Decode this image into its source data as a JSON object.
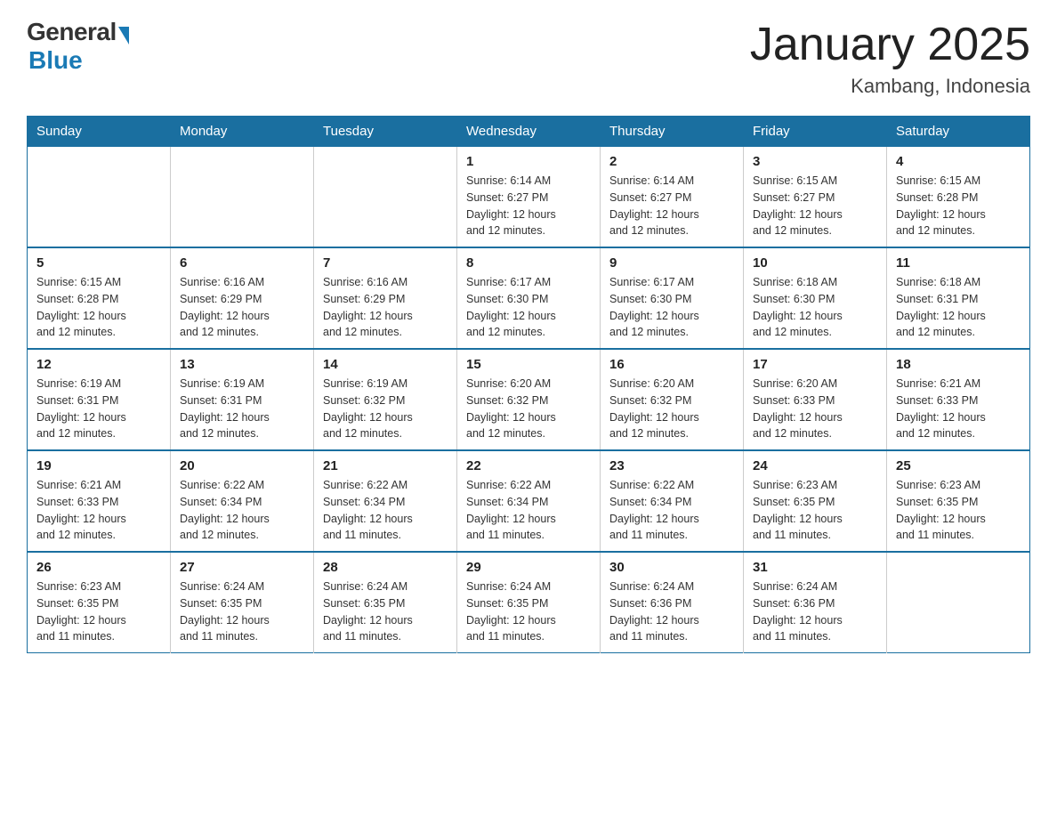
{
  "header": {
    "logo_general": "General",
    "logo_blue": "Blue",
    "title": "January 2025",
    "location": "Kambang, Indonesia"
  },
  "weekdays": [
    "Sunday",
    "Monday",
    "Tuesday",
    "Wednesday",
    "Thursday",
    "Friday",
    "Saturday"
  ],
  "weeks": [
    [
      {
        "day": "",
        "info": ""
      },
      {
        "day": "",
        "info": ""
      },
      {
        "day": "",
        "info": ""
      },
      {
        "day": "1",
        "info": "Sunrise: 6:14 AM\nSunset: 6:27 PM\nDaylight: 12 hours\nand 12 minutes."
      },
      {
        "day": "2",
        "info": "Sunrise: 6:14 AM\nSunset: 6:27 PM\nDaylight: 12 hours\nand 12 minutes."
      },
      {
        "day": "3",
        "info": "Sunrise: 6:15 AM\nSunset: 6:27 PM\nDaylight: 12 hours\nand 12 minutes."
      },
      {
        "day": "4",
        "info": "Sunrise: 6:15 AM\nSunset: 6:28 PM\nDaylight: 12 hours\nand 12 minutes."
      }
    ],
    [
      {
        "day": "5",
        "info": "Sunrise: 6:15 AM\nSunset: 6:28 PM\nDaylight: 12 hours\nand 12 minutes."
      },
      {
        "day": "6",
        "info": "Sunrise: 6:16 AM\nSunset: 6:29 PM\nDaylight: 12 hours\nand 12 minutes."
      },
      {
        "day": "7",
        "info": "Sunrise: 6:16 AM\nSunset: 6:29 PM\nDaylight: 12 hours\nand 12 minutes."
      },
      {
        "day": "8",
        "info": "Sunrise: 6:17 AM\nSunset: 6:30 PM\nDaylight: 12 hours\nand 12 minutes."
      },
      {
        "day": "9",
        "info": "Sunrise: 6:17 AM\nSunset: 6:30 PM\nDaylight: 12 hours\nand 12 minutes."
      },
      {
        "day": "10",
        "info": "Sunrise: 6:18 AM\nSunset: 6:30 PM\nDaylight: 12 hours\nand 12 minutes."
      },
      {
        "day": "11",
        "info": "Sunrise: 6:18 AM\nSunset: 6:31 PM\nDaylight: 12 hours\nand 12 minutes."
      }
    ],
    [
      {
        "day": "12",
        "info": "Sunrise: 6:19 AM\nSunset: 6:31 PM\nDaylight: 12 hours\nand 12 minutes."
      },
      {
        "day": "13",
        "info": "Sunrise: 6:19 AM\nSunset: 6:31 PM\nDaylight: 12 hours\nand 12 minutes."
      },
      {
        "day": "14",
        "info": "Sunrise: 6:19 AM\nSunset: 6:32 PM\nDaylight: 12 hours\nand 12 minutes."
      },
      {
        "day": "15",
        "info": "Sunrise: 6:20 AM\nSunset: 6:32 PM\nDaylight: 12 hours\nand 12 minutes."
      },
      {
        "day": "16",
        "info": "Sunrise: 6:20 AM\nSunset: 6:32 PM\nDaylight: 12 hours\nand 12 minutes."
      },
      {
        "day": "17",
        "info": "Sunrise: 6:20 AM\nSunset: 6:33 PM\nDaylight: 12 hours\nand 12 minutes."
      },
      {
        "day": "18",
        "info": "Sunrise: 6:21 AM\nSunset: 6:33 PM\nDaylight: 12 hours\nand 12 minutes."
      }
    ],
    [
      {
        "day": "19",
        "info": "Sunrise: 6:21 AM\nSunset: 6:33 PM\nDaylight: 12 hours\nand 12 minutes."
      },
      {
        "day": "20",
        "info": "Sunrise: 6:22 AM\nSunset: 6:34 PM\nDaylight: 12 hours\nand 12 minutes."
      },
      {
        "day": "21",
        "info": "Sunrise: 6:22 AM\nSunset: 6:34 PM\nDaylight: 12 hours\nand 11 minutes."
      },
      {
        "day": "22",
        "info": "Sunrise: 6:22 AM\nSunset: 6:34 PM\nDaylight: 12 hours\nand 11 minutes."
      },
      {
        "day": "23",
        "info": "Sunrise: 6:22 AM\nSunset: 6:34 PM\nDaylight: 12 hours\nand 11 minutes."
      },
      {
        "day": "24",
        "info": "Sunrise: 6:23 AM\nSunset: 6:35 PM\nDaylight: 12 hours\nand 11 minutes."
      },
      {
        "day": "25",
        "info": "Sunrise: 6:23 AM\nSunset: 6:35 PM\nDaylight: 12 hours\nand 11 minutes."
      }
    ],
    [
      {
        "day": "26",
        "info": "Sunrise: 6:23 AM\nSunset: 6:35 PM\nDaylight: 12 hours\nand 11 minutes."
      },
      {
        "day": "27",
        "info": "Sunrise: 6:24 AM\nSunset: 6:35 PM\nDaylight: 12 hours\nand 11 minutes."
      },
      {
        "day": "28",
        "info": "Sunrise: 6:24 AM\nSunset: 6:35 PM\nDaylight: 12 hours\nand 11 minutes."
      },
      {
        "day": "29",
        "info": "Sunrise: 6:24 AM\nSunset: 6:35 PM\nDaylight: 12 hours\nand 11 minutes."
      },
      {
        "day": "30",
        "info": "Sunrise: 6:24 AM\nSunset: 6:36 PM\nDaylight: 12 hours\nand 11 minutes."
      },
      {
        "day": "31",
        "info": "Sunrise: 6:24 AM\nSunset: 6:36 PM\nDaylight: 12 hours\nand 11 minutes."
      },
      {
        "day": "",
        "info": ""
      }
    ]
  ]
}
